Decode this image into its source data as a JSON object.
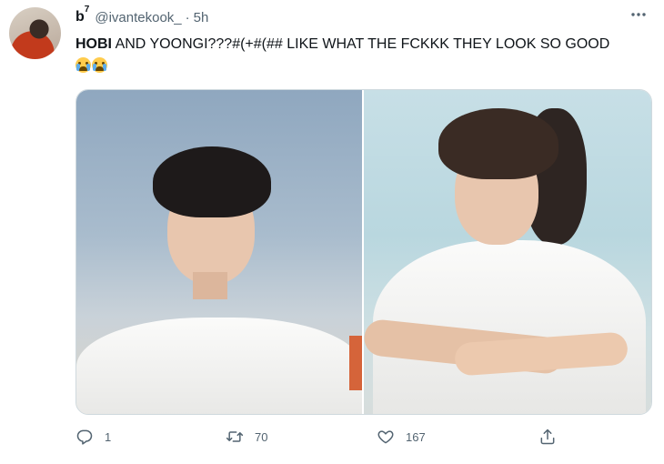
{
  "tweet": {
    "display_name": "b",
    "display_name_sup": "7",
    "handle": "@ivantekook_",
    "separator": "·",
    "time": "5h",
    "more_icon": "ellipsis-icon",
    "text_bold": "HOBI",
    "text_rest": " AND YOONGI???#(+#(## LIKE WHAT THE FCKKK THEY LOOK SO GOOD",
    "emojis": [
      "loudly-crying-face",
      "loudly-crying-face"
    ]
  },
  "media": {
    "photos": [
      "photo-left",
      "photo-right"
    ]
  },
  "actions": {
    "reply_count": "1",
    "retweet_count": "70",
    "like_count": "167"
  },
  "colors": {
    "secondary_text": "#536471",
    "border": "#cfd9de",
    "primary_text": "#0f1419"
  }
}
